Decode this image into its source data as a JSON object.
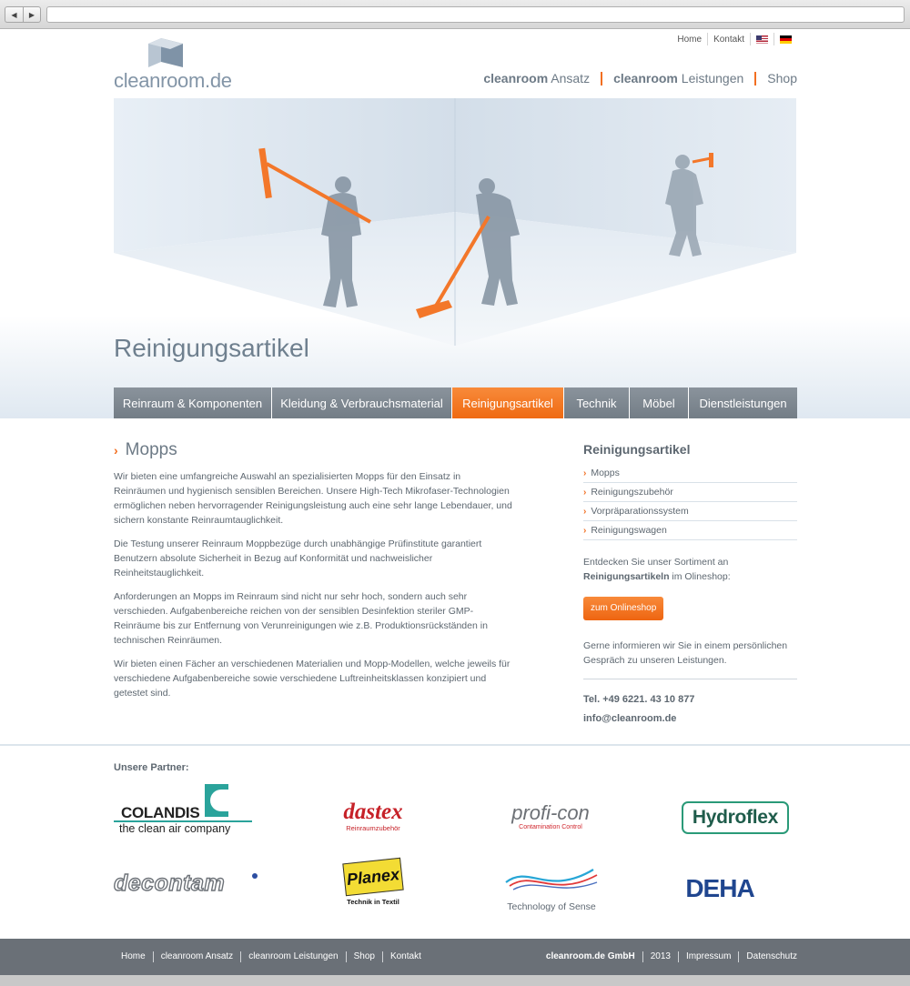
{
  "browser": {
    "back_icon": "back-arrow-icon",
    "forward_icon": "forward-arrow-icon",
    "url": ""
  },
  "toplinks": {
    "home": "Home",
    "kontakt": "Kontakt"
  },
  "logo": {
    "word": "cleanroom",
    "tld": ".de"
  },
  "mainnav": [
    {
      "bold": "cleanroom",
      "rest": " Ansatz"
    },
    {
      "bold": "cleanroom",
      "rest": " Leistungen"
    },
    {
      "bold": "",
      "rest": "Shop"
    }
  ],
  "hero": {
    "title": "Reinigungsartikel"
  },
  "catnav": [
    {
      "label": "Reinraum & Komponenten"
    },
    {
      "label": "Kleidung & Verbrauchsmaterial"
    },
    {
      "label": "Reinigungsartikel"
    },
    {
      "label": "Technik"
    },
    {
      "label": "Möbel"
    },
    {
      "label": "Dienstleistungen"
    }
  ],
  "content": {
    "heading": "Mopps",
    "paragraphs": [
      "Wir bieten eine umfangreiche Auswahl an spezialisierten Mopps für den Einsatz in Reinräumen und hygienisch sensiblen Bereichen. Unsere High-Tech Mikrofaser-Technologien ermöglichen neben hervorragender Reinigungsleistung auch eine sehr lange Lebendauer, und sichern konstante Reinraumtauglichkeit.",
      "Die Testung unserer Reinraum Moppbezüge durch unabhängige Prüfinstitute garantiert Benutzern absolute Sicherheit in Bezug auf Konformität und nachweislicher Reinheitstauglichkeit.",
      "Anforderungen an Mopps im Reinraum sind nicht nur sehr hoch, sondern auch sehr verschieden. Aufgabenbereiche reichen von der sensiblen Desinfektion steriler GMP-Reinräume bis zur Entfernung von Verunreinigungen wie z.B. Produktionsrückständen in technischen Reinräumen.",
      "Wir bieten einen Fächer an verschiedenen Materialien und Mopp-Modellen, welche jeweils für verschiedene Aufgabenbereiche sowie verschiedene Luftreinheitsklassen konzipiert und getestet sind."
    ]
  },
  "sidebar": {
    "title": "Reinigungsartikel",
    "items": [
      {
        "label": "Mopps"
      },
      {
        "label": "Reinigungszubehör"
      },
      {
        "label": "Vorpräparationssystem"
      },
      {
        "label": "Reinigungswagen"
      }
    ],
    "shop_text_1": "Entdecken Sie unser Sortiment an",
    "shop_text_bold": "Reinigungsartikeln",
    "shop_text_2": " im Olineshop:",
    "shop_button": "zum Onlineshop",
    "info_text": "Gerne informieren wir Sie in einem persönlichen Gespräch zu unseren Leistungen.",
    "phone": "Tel. +49 6221. 43 10 877",
    "email": "info@cleanroom.de"
  },
  "partners": {
    "title": "Unsere Partner:",
    "colandis": {
      "name": "COLANDIS",
      "tagline": "the clean air company"
    },
    "dastex": {
      "name": "dastex",
      "tagline": "Reinraumzubehör"
    },
    "proficon": {
      "name": "profi-con",
      "tagline": "Contamination Control"
    },
    "hydroflex": {
      "name": "Hydroflex"
    },
    "decontam": {
      "name": "decontam"
    },
    "planex": {
      "name": "Planex",
      "tagline": "Technik in Textil"
    },
    "tos": {
      "name": "Technology of Sense"
    },
    "deha": {
      "name": "DEHA"
    }
  },
  "footer": {
    "left": [
      "Home",
      "cleanroom Ansatz",
      "cleanroom Leistungen",
      "Shop",
      "Kontakt"
    ],
    "company": "cleanroom.de GmbH",
    "year": "2013",
    "impressum": "Impressum",
    "datenschutz": "Datenschutz"
  },
  "colors": {
    "accent": "#f26f21",
    "nav_gray": "#7e8891",
    "footer": "#6a7077"
  }
}
